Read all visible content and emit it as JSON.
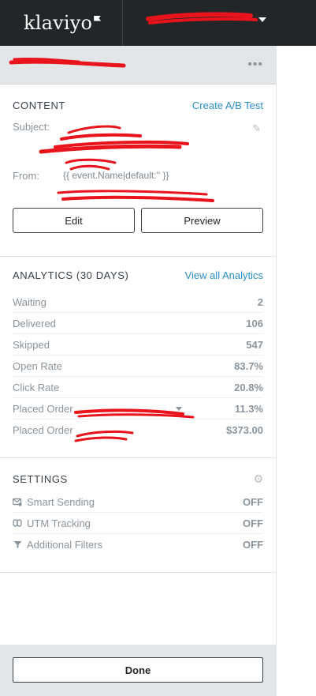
{
  "topbar": {
    "brand": "klaviyo",
    "account_name": ""
  },
  "panel": {
    "header_name": "",
    "more_label": "•••"
  },
  "content": {
    "title": "CONTENT",
    "create_ab_test": "Create A/B Test",
    "subject_label": "Subject:",
    "subject_value": "",
    "from_label": "From:",
    "from_value_line1": "{{ event.Name|default:'' }}",
    "from_value_line2": "",
    "edit_button": "Edit",
    "preview_button": "Preview"
  },
  "analytics": {
    "title": "ANALYTICS (30 DAYS)",
    "view_all": "View all Analytics",
    "rows": [
      {
        "label": "Waiting",
        "value": "2"
      },
      {
        "label": "Delivered",
        "value": "106"
      },
      {
        "label": "Skipped",
        "value": "547"
      },
      {
        "label": "Open Rate",
        "value": "83.7%"
      },
      {
        "label": "Click Rate",
        "value": "20.8%"
      },
      {
        "label": "Placed Order",
        "value": "11.3%"
      },
      {
        "label": "Placed Order",
        "value": "$373.00"
      }
    ]
  },
  "settings": {
    "title": "SETTINGS",
    "rows": [
      {
        "label": "Smart Sending",
        "value": "OFF",
        "icon": "smart-sending-icon"
      },
      {
        "label": "UTM Tracking",
        "value": "OFF",
        "icon": "utm-tracking-icon"
      },
      {
        "label": "Additional Filters",
        "value": "OFF",
        "icon": "filter-icon"
      }
    ]
  },
  "footer": {
    "done_button": "Done"
  },
  "colors": {
    "topbar": "#222629",
    "accent_link": "#2a8ec8",
    "panel_header": "#e3e6e9",
    "redaction": "#e8131b"
  }
}
